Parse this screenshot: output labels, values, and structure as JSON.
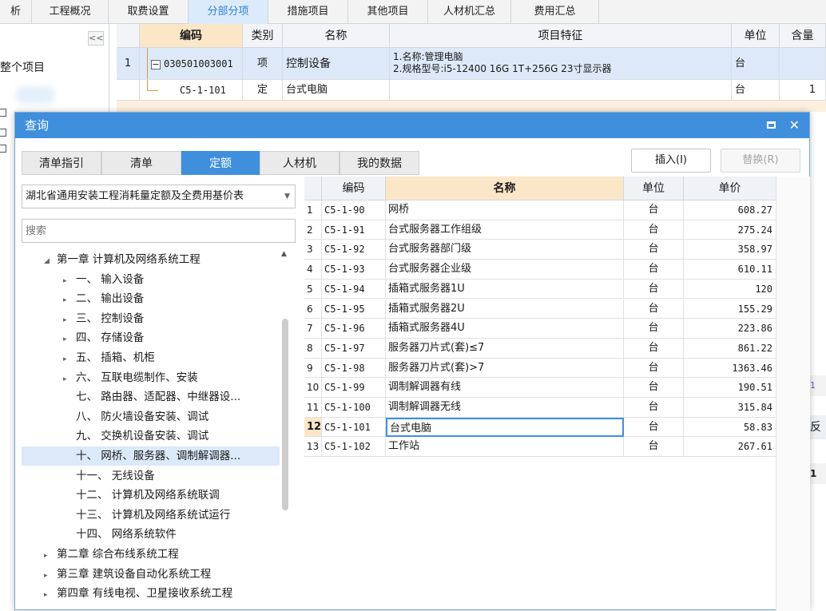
{
  "top_tabs": [
    {
      "label": "析",
      "active": false
    },
    {
      "label": "工程概况",
      "active": false
    },
    {
      "label": "取费设置",
      "active": false
    },
    {
      "label": "分部分项",
      "active": true
    },
    {
      "label": "措施项目",
      "active": false
    },
    {
      "label": "其他项目",
      "active": false
    },
    {
      "label": "人材机汇总",
      "active": false
    },
    {
      "label": "费用汇总",
      "active": false
    }
  ],
  "main_left": {
    "collapse_glyph": "<<",
    "whole_project": "整个项目"
  },
  "main_grid": {
    "headers": [
      "编码",
      "类别",
      "名称",
      "项目特征",
      "单位",
      "含量"
    ],
    "rows": [
      {
        "num": "1",
        "toggle": "−",
        "code": "030501003001",
        "type": "项",
        "name": "控制设备",
        "feature_line1": "1.名称:管理电脑",
        "feature_line2": "2.规格型号:i5-12400 16G 1T+256G 23寸显示器",
        "unit": "台",
        "qty": ""
      },
      {
        "num": "",
        "toggle": "",
        "code": "C5-1-101",
        "type": "定",
        "name": "台式电脑",
        "feature_line1": "",
        "feature_line2": "",
        "unit": "台",
        "qty": "1"
      }
    ]
  },
  "right_glimpses": {
    "a": "1",
    "b": "反",
    "c": "1"
  },
  "dialog": {
    "title": "查询",
    "tabs": [
      {
        "label": "清单指引",
        "active": false
      },
      {
        "label": "清单",
        "active": false
      },
      {
        "label": "定额",
        "active": true
      },
      {
        "label": "人材机",
        "active": false
      },
      {
        "label": "我的数据",
        "active": false
      }
    ],
    "insert_button": "插入(I)",
    "replace_button": "替换(R)",
    "library_select": "湖北省通用安装工程消耗量定额及全费用基价表",
    "search_placeholder": "搜索",
    "tree": [
      {
        "label": "第一章 计算机及网络系统工程",
        "indent": 0,
        "arrow": "◢",
        "selected": false
      },
      {
        "label": "一、 输入设备",
        "indent": 1,
        "arrow": "▸",
        "selected": false
      },
      {
        "label": "二、 输出设备",
        "indent": 1,
        "arrow": "▸",
        "selected": false
      },
      {
        "label": "三、 控制设备",
        "indent": 1,
        "arrow": "▸",
        "selected": false
      },
      {
        "label": "四、 存储设备",
        "indent": 1,
        "arrow": "▸",
        "selected": false
      },
      {
        "label": "五、 插箱、机柜",
        "indent": 1,
        "arrow": "▸",
        "selected": false
      },
      {
        "label": "六、 互联电缆制作、安装",
        "indent": 1,
        "arrow": "▸",
        "selected": false
      },
      {
        "label": "七、 路由器、适配器、中继器设...",
        "indent": 1,
        "arrow": "",
        "selected": false
      },
      {
        "label": "八、 防火墙设备安装、调试",
        "indent": 1,
        "arrow": "",
        "selected": false
      },
      {
        "label": "九、 交换机设备安装、调试",
        "indent": 1,
        "arrow": "",
        "selected": false
      },
      {
        "label": "十、 网桥、服务器、调制解调器...",
        "indent": 1,
        "arrow": "",
        "selected": true
      },
      {
        "label": "十一、 无线设备",
        "indent": 1,
        "arrow": "",
        "selected": false
      },
      {
        "label": "十二、 计算机及网络系统联调",
        "indent": 1,
        "arrow": "",
        "selected": false
      },
      {
        "label": "十三、 计算机及网络系统试运行",
        "indent": 1,
        "arrow": "",
        "selected": false
      },
      {
        "label": "十四、 网络系统软件",
        "indent": 1,
        "arrow": "",
        "selected": false
      },
      {
        "label": "第二章 综合布线系统工程",
        "indent": 0,
        "arrow": "▸",
        "selected": false
      },
      {
        "label": "第三章 建筑设备自动化系统工程",
        "indent": 0,
        "arrow": "▸",
        "selected": false
      },
      {
        "label": "第四章 有线电视、卫星接收系统工程",
        "indent": 0,
        "arrow": "▸",
        "selected": false
      }
    ],
    "quota_headers": [
      "编码",
      "名称",
      "单位",
      "单价"
    ],
    "quota_rows": [
      {
        "num": "1",
        "code": "C5-1-90",
        "name": "网桥",
        "unit": "台",
        "price": "608.27"
      },
      {
        "num": "2",
        "code": "C5-1-91",
        "name": "台式服务器工作组级",
        "unit": "台",
        "price": "275.24"
      },
      {
        "num": "3",
        "code": "C5-1-92",
        "name": "台式服务器部门级",
        "unit": "台",
        "price": "358.97"
      },
      {
        "num": "4",
        "code": "C5-1-93",
        "name": "台式服务器企业级",
        "unit": "台",
        "price": "610.11"
      },
      {
        "num": "5",
        "code": "C5-1-94",
        "name": "插箱式服务器1U",
        "unit": "台",
        "price": "120"
      },
      {
        "num": "6",
        "code": "C5-1-95",
        "name": "插箱式服务器2U",
        "unit": "台",
        "price": "155.29"
      },
      {
        "num": "7",
        "code": "C5-1-96",
        "name": "插箱式服务器4U",
        "unit": "台",
        "price": "223.86"
      },
      {
        "num": "8",
        "code": "C5-1-97",
        "name": "服务器刀片式(套)≤7",
        "unit": "台",
        "price": "861.22"
      },
      {
        "num": "9",
        "code": "C5-1-98",
        "name": "服务器刀片式(套)>7",
        "unit": "台",
        "price": "1363.46"
      },
      {
        "num": "10",
        "code": "C5-1-99",
        "name": "调制解调器有线",
        "unit": "台",
        "price": "190.51"
      },
      {
        "num": "11",
        "code": "C5-1-100",
        "name": "调制解调器无线",
        "unit": "台",
        "price": "315.84"
      },
      {
        "num": "12",
        "code": "C5-1-101",
        "name": "台式电脑",
        "unit": "台",
        "price": "58.83",
        "selected": true
      },
      {
        "num": "13",
        "code": "C5-1-102",
        "name": "工作站",
        "unit": "台",
        "price": "267.61"
      }
    ]
  }
}
